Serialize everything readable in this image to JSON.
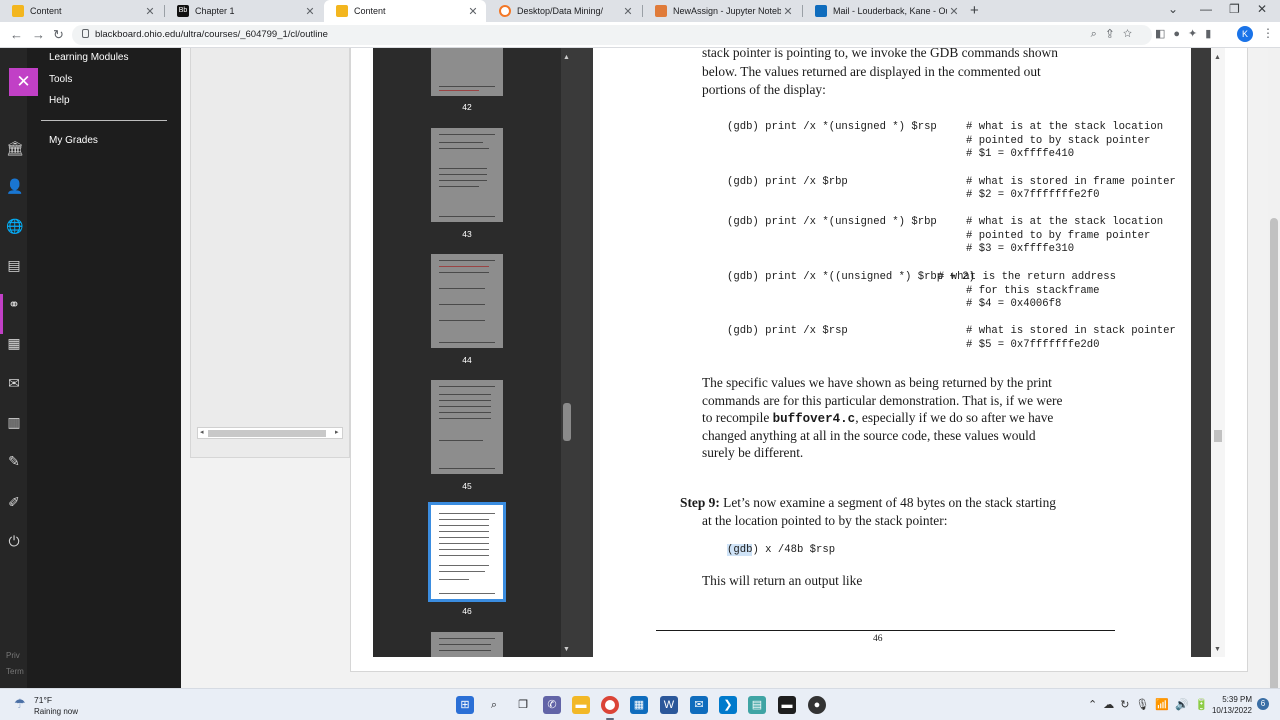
{
  "browser": {
    "tabs": [
      {
        "label": "Content",
        "favicon_color": "#f3b61f"
      },
      {
        "label": "Chapter 1",
        "favicon_color": "#111111"
      },
      {
        "label": "Content",
        "favicon_color": "#f3b61f",
        "active": true
      },
      {
        "label": "Desktop/Data Mining/",
        "favicon_color": "#f37726"
      },
      {
        "label": "NewAssign - Jupyter Notebook",
        "favicon_color": "#e07b39"
      },
      {
        "label": "Mail - Louderback, Kane - Outlo",
        "favicon_color": "#0f6cbd"
      }
    ],
    "url": "blackboard.ohio.edu/ultra/courses/_604799_1/cl/outline",
    "profile_initial": "K"
  },
  "course_nav": {
    "items": [
      "Learning Modules",
      "Tools",
      "Help",
      "My Grades"
    ],
    "footer": [
      "Priv",
      "Term"
    ]
  },
  "pdf": {
    "thumbnails": [
      "42",
      "43",
      "44",
      "45",
      "46"
    ],
    "selected_page": "46",
    "intro_lines": [
      "stack pointer is pointing to, we invoke the GDB commands shown",
      "below. The values returned are displayed in the commented out",
      "portions of the display:"
    ],
    "code_blocks": [
      {
        "command": "(gdb) print /x *(unsigned *) $rsp",
        "comments": [
          "# what is at the stack location",
          "# pointed to by stack pointer",
          "#  $1 = 0xffffe410"
        ]
      },
      {
        "command": "(gdb) print /x $rbp",
        "comments": [
          "# what is stored in frame pointer",
          "#  $2 = 0x7fffffffe2f0"
        ]
      },
      {
        "command": "(gdb) print /x *(unsigned *) $rbp",
        "comments": [
          "# what is at the stack location",
          "# pointed to by frame pointer",
          "#  $3 = 0xffffe310"
        ]
      },
      {
        "command": "(gdb) print /x *((unsigned *) $rbp + 2)",
        "comments": [
          "# what is the return address",
          "# for this stackframe",
          "#  $4 = 0x4006f8"
        ]
      },
      {
        "command": "(gdb) print /x $rsp",
        "comments": [
          "# what is stored in stack pointer",
          "#  $5 = 0x7fffffffe2d0"
        ]
      }
    ],
    "para_lines": [
      "The specific values we have shown as being returned by the print",
      "commands are for this particular demonstration. That is, if we were",
      "to recompile",
      "buffover4.c",
      ", especially if we do so after we have",
      "changed anything at all in the source code, these values would",
      "surely be different."
    ],
    "step": {
      "label": "Step 9:",
      "line1": "Let’s now examine a segment of 48 bytes on the stack starting",
      "line2": "at the location pointed to by the stack pointer:"
    },
    "step_cmd_prefix": "(gdb",
    "step_cmd_rest": ")    x /48b $rsp",
    "after_step": "This will return an output like",
    "page_number": "46"
  },
  "taskbar": {
    "temperature": "71°F",
    "condition": "Raining now",
    "time": "5:39 PM",
    "date": "10/13/2022",
    "notifications": "6"
  }
}
